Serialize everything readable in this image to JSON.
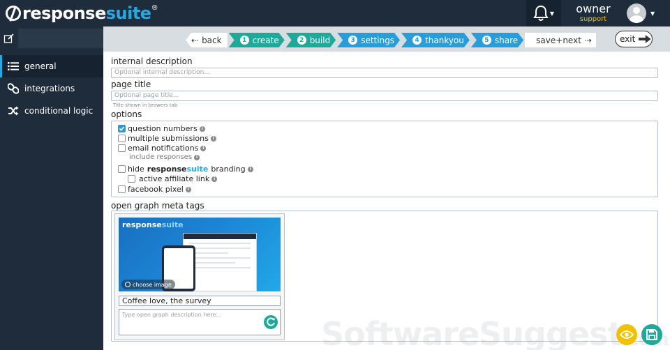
{
  "header": {
    "logo_part1": "response",
    "logo_part2": "suite",
    "logo_reg": "®",
    "user_name": "owner",
    "user_role": "support"
  },
  "sidebar": {
    "items": [
      {
        "label": "general",
        "icon": "list-icon",
        "active": true
      },
      {
        "label": "integrations",
        "icon": "link-icon",
        "active": false
      },
      {
        "label": "conditional logic",
        "icon": "shuffle-icon",
        "active": false
      }
    ]
  },
  "steps": {
    "back": "back",
    "items": [
      {
        "num": "1",
        "label": "create"
      },
      {
        "num": "2",
        "label": "build"
      },
      {
        "num": "3",
        "label": "settings"
      },
      {
        "num": "4",
        "label": "thankyou"
      },
      {
        "num": "5",
        "label": "share"
      }
    ],
    "save_next": "save+next",
    "exit": "exit"
  },
  "form": {
    "internal_description_label": "internal description",
    "internal_description_placeholder": "Optional internal description...",
    "page_title_label": "page title",
    "page_title_placeholder": "Optional page title...",
    "page_title_hint": "Title shown in browers tab",
    "options_label": "options",
    "options": {
      "question_numbers": "question numbers",
      "multiple_submissions": "multiple submissions",
      "email_notifications": "email notifications",
      "include_responses": "include responses",
      "hide_prefix": "hide",
      "brand_part1": "response",
      "brand_part2": "suite",
      "branding": "branding",
      "active_affiliate_link": "active affiliate link",
      "facebook_pixel": "facebook pixel"
    },
    "og_label": "open graph meta tags",
    "og": {
      "choose_image": "choose image",
      "title_value": "Coffee love, the survey",
      "description_placeholder": "Type open graph description here..."
    }
  },
  "watermark": {
    "main": "SoftwareSuggest",
    "suffix": ".com"
  },
  "colors": {
    "navy": "#1e2c3b",
    "teal": "#1fa99a",
    "blue": "#2a9cd8",
    "yellow": "#f2c200"
  }
}
